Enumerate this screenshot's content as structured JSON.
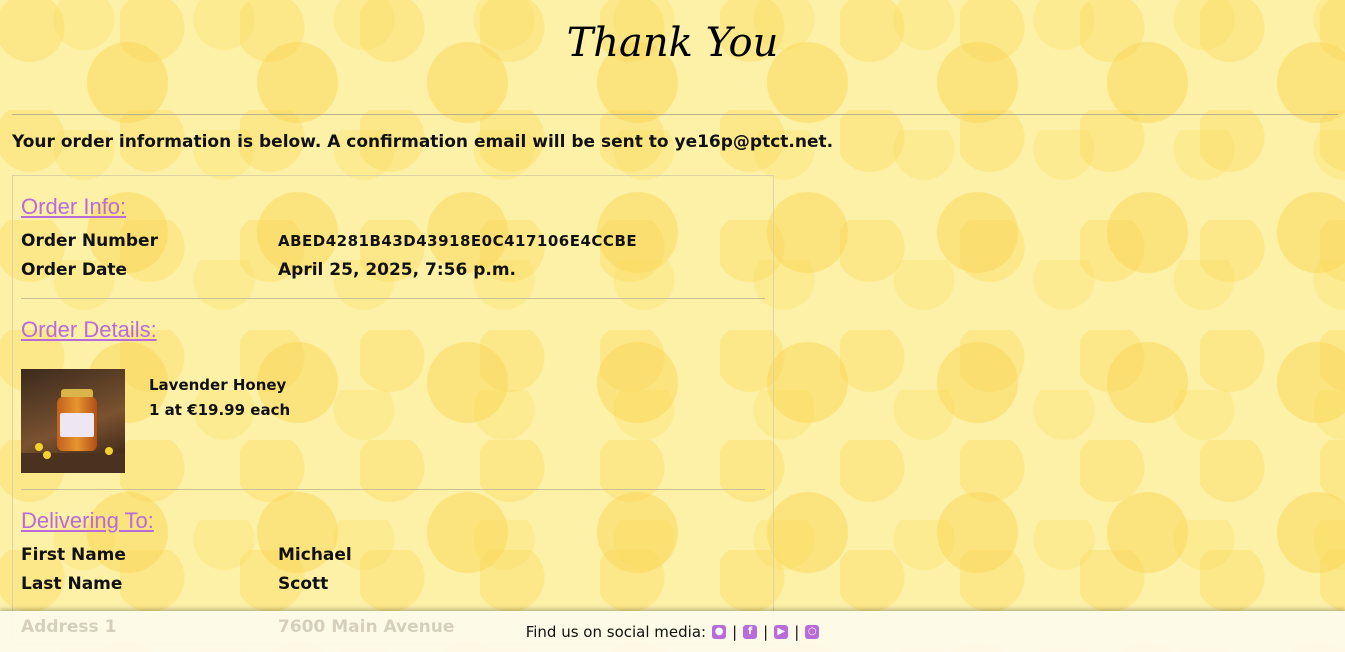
{
  "page": {
    "title": "Thank You",
    "intro_prefix": "Your order information is below. A confirmation email will be sent to",
    "email": "ye16p@ptct.net",
    "intro_suffix": "."
  },
  "order_info": {
    "heading": "Order Info:",
    "rows": [
      {
        "label": "Order Number",
        "value": "ABED4281B43D43918E0C417106E4CCBE"
      },
      {
        "label": "Order Date",
        "value": "April 25, 2025, 7:56 p.m."
      }
    ]
  },
  "order_details": {
    "heading": "Order Details:",
    "items": [
      {
        "name": "Lavender Honey",
        "quantity_line": "1 at €19.99 each"
      }
    ]
  },
  "delivery": {
    "heading": "Delivering To:",
    "rows": [
      {
        "label": "First Name",
        "value": "Michael"
      },
      {
        "label": "Last Name",
        "value": "Scott"
      },
      {
        "label": "Address 1",
        "value": "7600 Main Avenue"
      }
    ]
  },
  "footer": {
    "text": "Find us on social media:",
    "icons": [
      "github-icon",
      "facebook-icon",
      "youtube-icon",
      "instagram-icon"
    ],
    "separator": "|"
  },
  "colors": {
    "accent": "#b86bd9",
    "background": "#fdf1a8"
  }
}
